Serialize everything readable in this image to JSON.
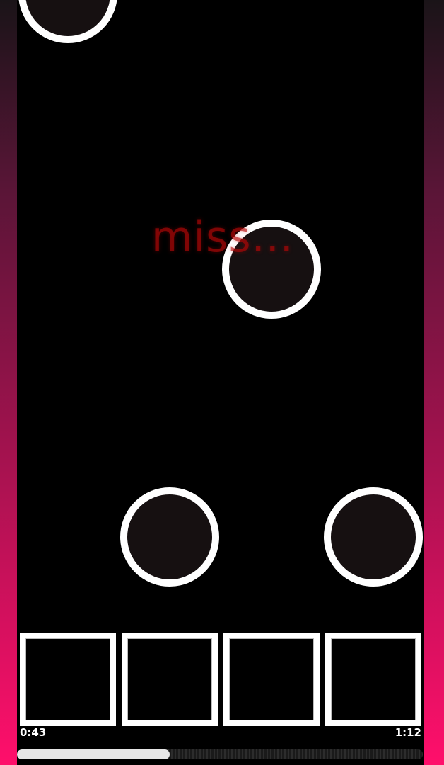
{
  "game": {
    "judgement_text": "miss...",
    "notes": [
      {
        "lane": 1,
        "kind": "tap"
      },
      {
        "lane": 3,
        "kind": "tap"
      },
      {
        "lane": 2,
        "kind": "tap"
      },
      {
        "lane": 4,
        "kind": "tap"
      }
    ],
    "lanes": [
      "lane-1",
      "lane-2",
      "lane-3",
      "lane-4"
    ]
  },
  "playback": {
    "elapsed": "0:43",
    "total": "1:12",
    "progress_fraction": 0.376
  },
  "colors": {
    "accent": "#ff0f6b",
    "note_fill": "#161011",
    "note_ring": "#ffffff",
    "judgement": "#b40808"
  }
}
